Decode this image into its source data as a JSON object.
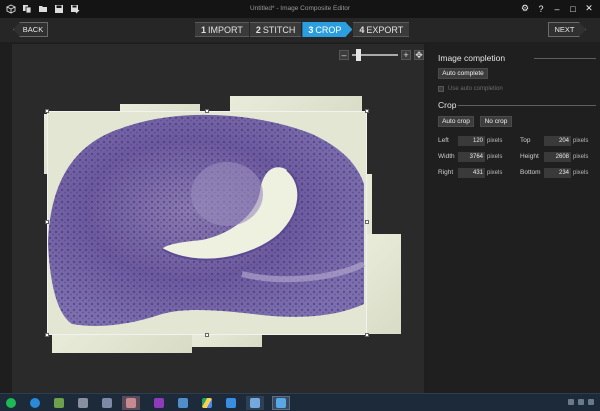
{
  "window": {
    "title": "Untitled* - Image Composite Editor",
    "toolbar_icons": [
      "new-project-icon",
      "new-project-from-files-icon",
      "open-folder-icon",
      "save-icon",
      "save-as-icon"
    ],
    "controls": [
      "settings-icon",
      "help-icon",
      "minimize-icon",
      "maximize-icon",
      "close-icon"
    ]
  },
  "nav": {
    "back_label": "BACK",
    "next_label": "NEXT",
    "steps": [
      {
        "num": "1",
        "label": "IMPORT",
        "active": false
      },
      {
        "num": "2",
        "label": "STITCH",
        "active": false
      },
      {
        "num": "3",
        "label": "CROP",
        "active": true
      },
      {
        "num": "4",
        "label": "EXPORT",
        "active": false
      }
    ]
  },
  "zoom": {
    "level": 0.1
  },
  "panel": {
    "image_completion": {
      "title": "Image completion",
      "auto_complete_label": "Auto complete",
      "use_auto_completion_label": "Use auto completion",
      "use_auto_completion_checked": false
    },
    "crop": {
      "title": "Crop",
      "auto_crop_label": "Auto crop",
      "no_crop_label": "No crop",
      "fields": {
        "left": {
          "label": "Left",
          "value": "120",
          "unit": "pixels"
        },
        "top": {
          "label": "Top",
          "value": "204",
          "unit": "pixels"
        },
        "width": {
          "label": "Width",
          "value": "3764",
          "unit": "pixels"
        },
        "height": {
          "label": "Height",
          "value": "2608",
          "unit": "pixels"
        },
        "right": {
          "label": "Right",
          "value": "431",
          "unit": "pixels"
        },
        "bottom": {
          "label": "Bottom",
          "value": "234",
          "unit": "pixels"
        }
      }
    }
  },
  "taskbar": {
    "apps": [
      "spotify-icon",
      "internet-explorer-icon",
      "gpu-tool-icon",
      "app-icon",
      "app-icon",
      "photo-app-icon",
      "onenote-icon",
      "image-viewer-icon",
      "google-drive-icon",
      "app-icon",
      "windows-icon",
      "chrome-icon",
      "image-composite-editor-icon"
    ],
    "active_index": 12
  }
}
